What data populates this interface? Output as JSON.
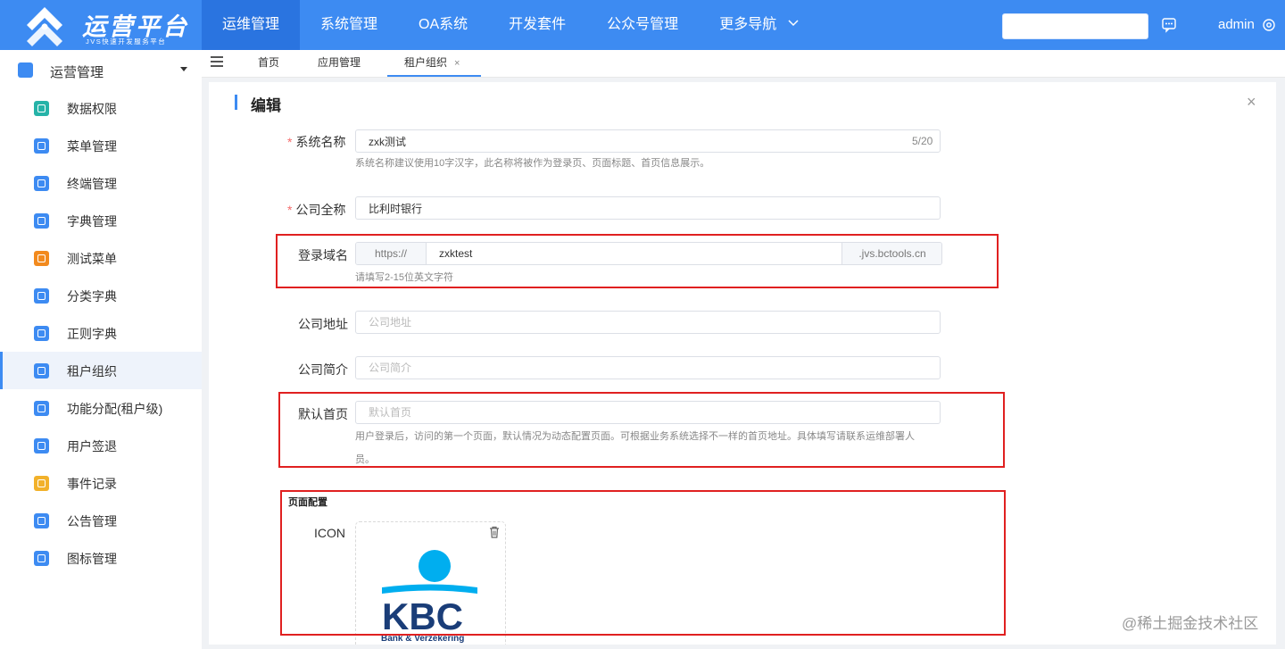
{
  "brand": {
    "title": "运营平台",
    "subtitle": "JVS快速开发服务平台",
    "primary_color": "#3d8bf2"
  },
  "topnav": {
    "items": [
      {
        "label": "运维管理",
        "active": true
      },
      {
        "label": "系统管理"
      },
      {
        "label": "OA系统"
      },
      {
        "label": "开发套件"
      },
      {
        "label": "公众号管理"
      },
      {
        "label": "更多导航",
        "dropdown": true
      }
    ],
    "search_value": "",
    "message_icon": "chat-icon",
    "user": "admin",
    "settings_icon": "gear-icon"
  },
  "sidebar": {
    "group": {
      "label": "运营管理",
      "icon": "gear-icon"
    },
    "items": [
      {
        "label": "数据权限",
        "icon": "save-icon",
        "color": "#26b3a8"
      },
      {
        "label": "菜单管理",
        "icon": "list-icon",
        "color": "#3d8bf2"
      },
      {
        "label": "终端管理",
        "icon": "scan-icon",
        "color": "#3d8bf2"
      },
      {
        "label": "字典管理",
        "icon": "home-icon",
        "color": "#3d8bf2"
      },
      {
        "label": "测试菜单",
        "icon": "home-icon",
        "color": "#f28a1e"
      },
      {
        "label": "分类字典",
        "icon": "chart-icon",
        "color": "#3d8bf2"
      },
      {
        "label": "正则字典",
        "icon": "globe-icon",
        "color": "#3d8bf2"
      },
      {
        "label": "租户组织",
        "icon": "monitor-icon",
        "color": "#3d8bf2",
        "active": true
      },
      {
        "label": "功能分配(租户级)",
        "icon": "box-icon",
        "color": "#3d8bf2"
      },
      {
        "label": "用户签退",
        "icon": "lock-icon",
        "color": "#3d8bf2"
      },
      {
        "label": "事件记录",
        "icon": "doc-icon",
        "color": "#f2b12a"
      },
      {
        "label": "公告管理",
        "icon": "image-icon",
        "color": "#3d8bf2"
      },
      {
        "label": "图标管理",
        "icon": "box-icon",
        "color": "#3d8bf2"
      }
    ]
  },
  "tabs": [
    {
      "label": "首页"
    },
    {
      "label": "应用管理"
    },
    {
      "label": "租户组织",
      "active": true,
      "close": "×"
    }
  ],
  "form": {
    "title": "编辑",
    "close": "×",
    "system_name": {
      "label": "系统名称",
      "value": "zxk测试",
      "count": "5/20",
      "hint": "系统名称建议使用10字汉字，此名称将被作为登录页、页面标题、首页信息展示。"
    },
    "company_name": {
      "label": "公司全称",
      "value": "比利时银行"
    },
    "login_domain": {
      "label": "登录域名",
      "prefix": "https://",
      "value": "zxktest",
      "suffix": ".jvs.bctools.cn",
      "hint": "请填写2-15位英文字符"
    },
    "company_address": {
      "label": "公司地址",
      "placeholder": "公司地址"
    },
    "company_intro": {
      "label": "公司简介",
      "placeholder": "公司简介"
    },
    "default_home": {
      "label": "默认首页",
      "placeholder": "默认首页",
      "hint_line1": "用户登录后，访问的第一个页面，默认情况为动态配置页面。可根据业务系统选择不一样的首页地址。具体填写请联系运维部署人",
      "hint_line2": "员。"
    },
    "page_config": {
      "title": "页面配置",
      "icon_label": "ICON",
      "logo_text": "KBC",
      "logo_subtext": "Bank & Verzekering"
    }
  },
  "watermark": "@稀土掘金技术社区"
}
